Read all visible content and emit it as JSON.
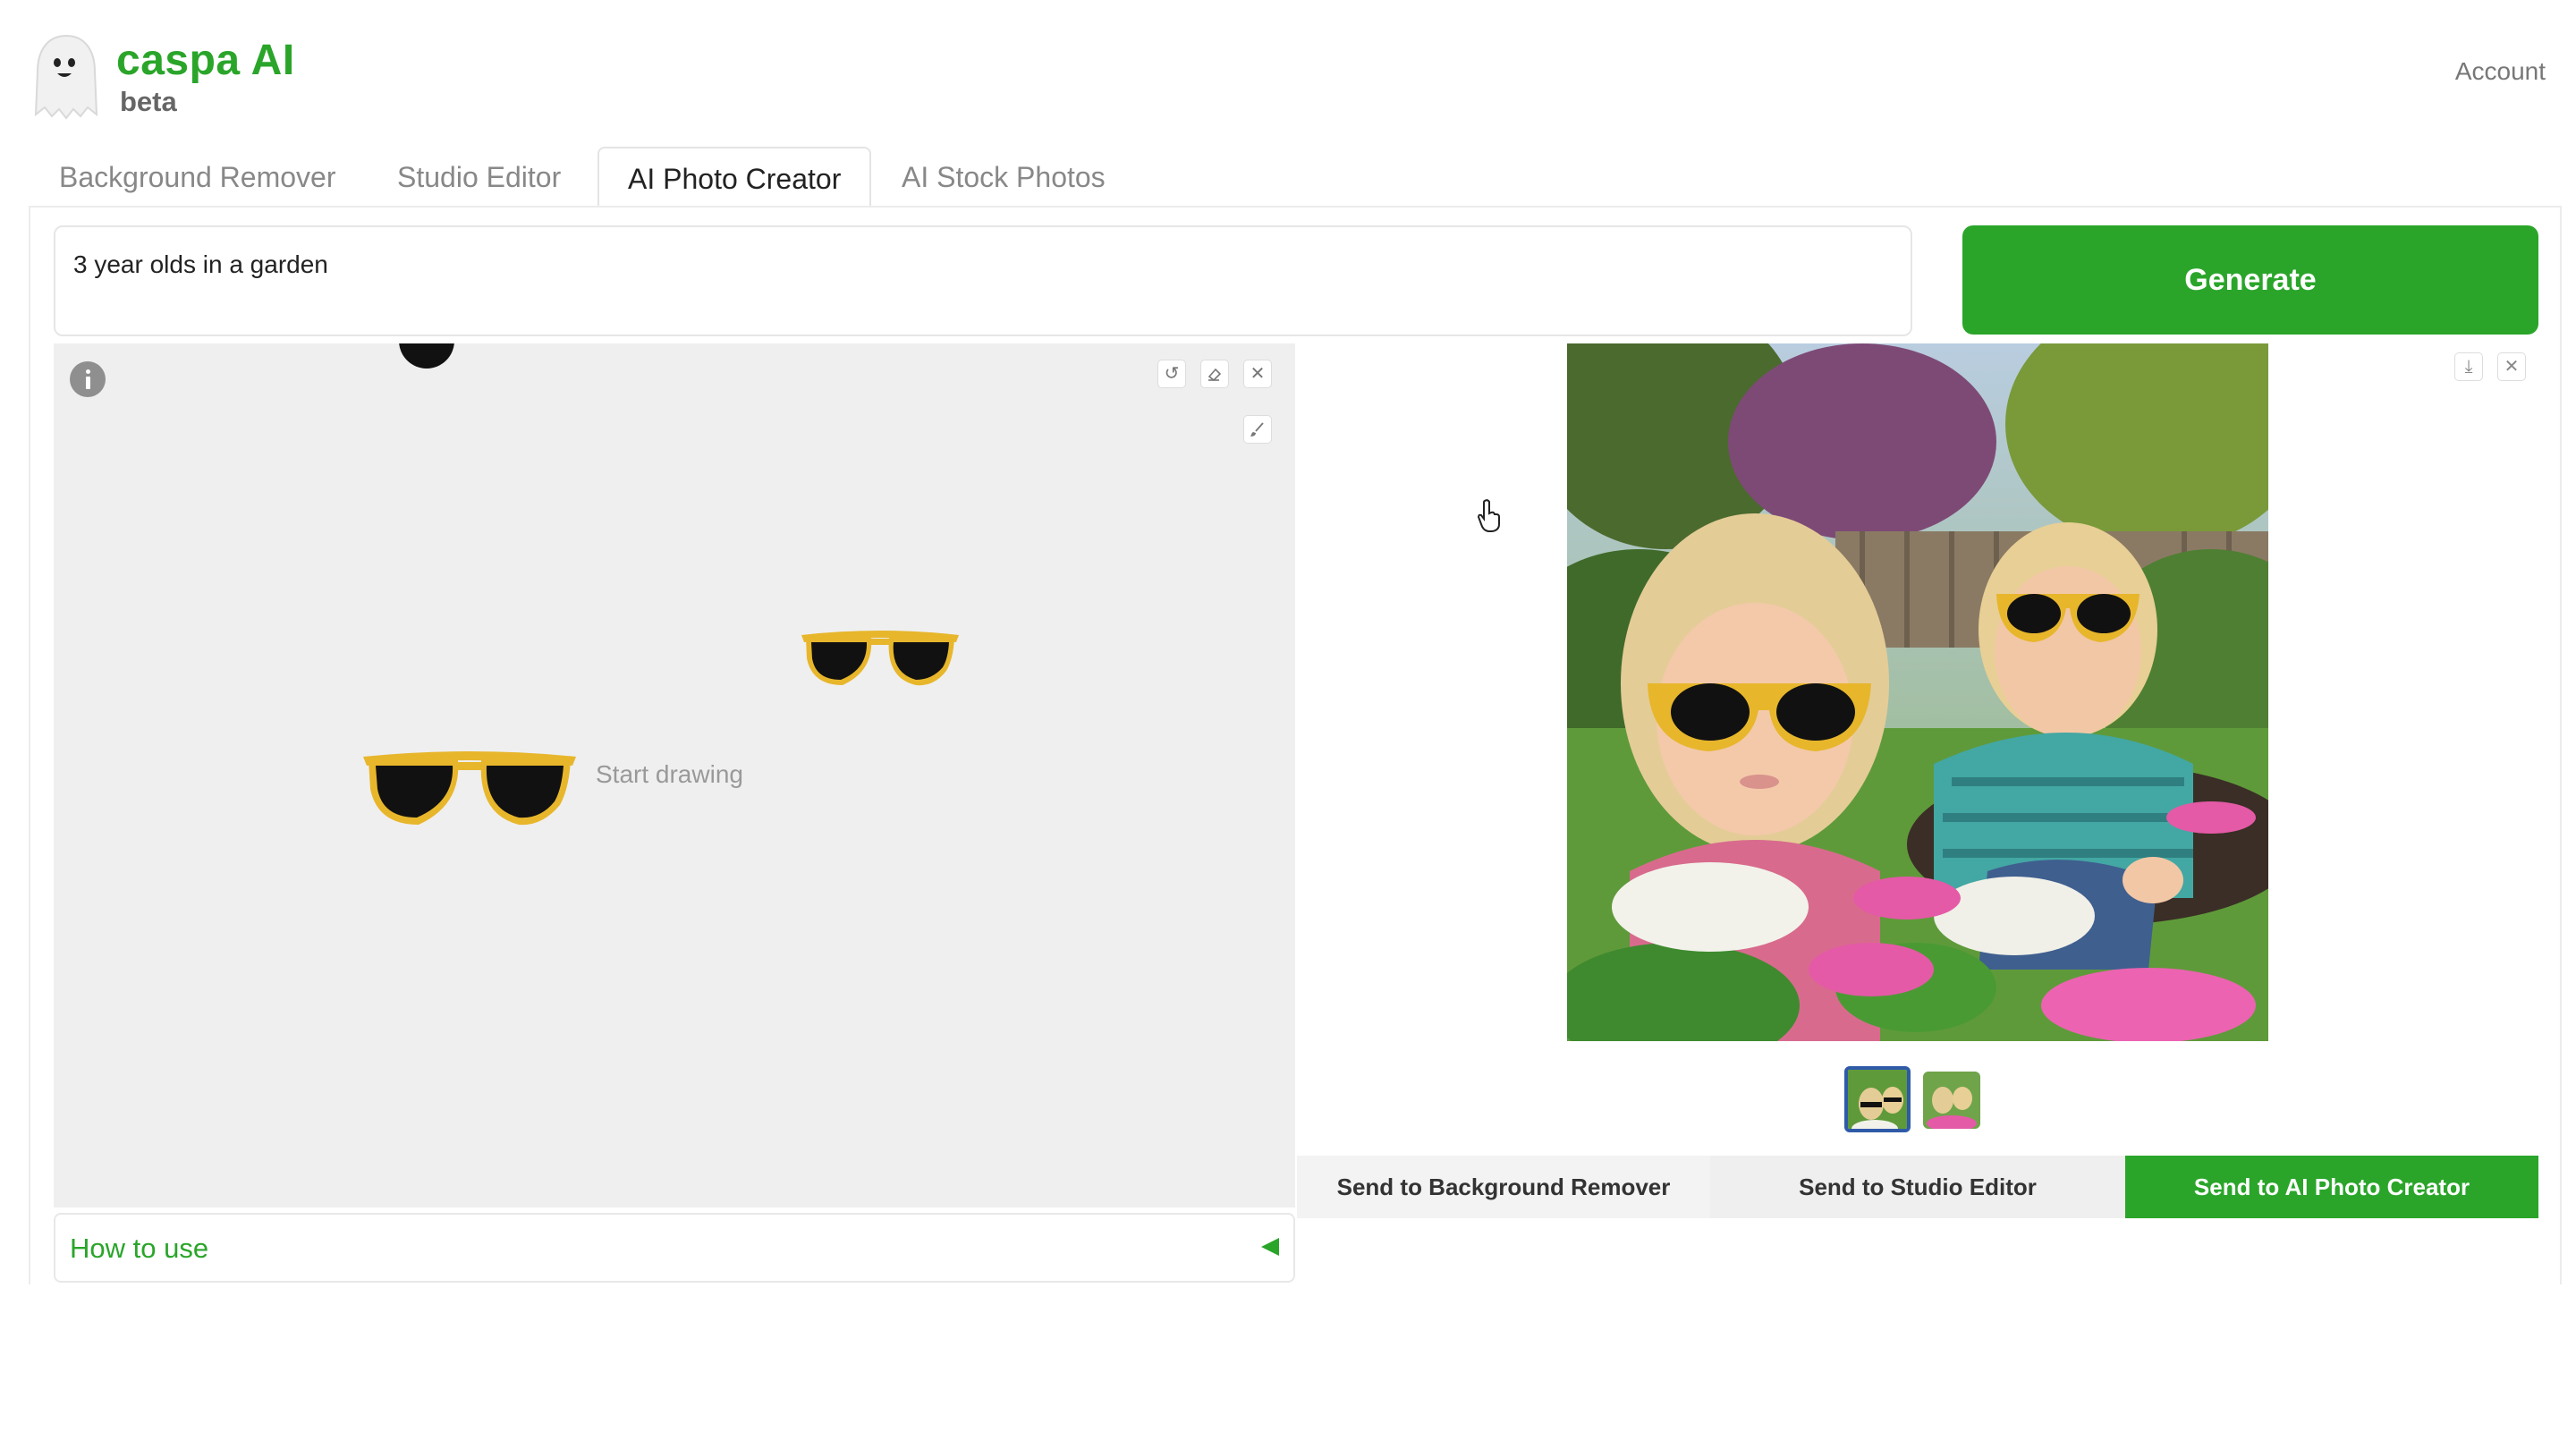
{
  "app": {
    "brand": "caspa AI",
    "badge": "beta",
    "account_label": "Account"
  },
  "tabs": [
    {
      "label": "Background Remover",
      "active": false
    },
    {
      "label": "Studio Editor",
      "active": false
    },
    {
      "label": "AI Photo Creator",
      "active": true
    },
    {
      "label": "AI Stock Photos",
      "active": false
    }
  ],
  "prompt": {
    "value": "3 year olds in a garden"
  },
  "generate_label": "Generate",
  "canvas": {
    "hint": "Start drawing"
  },
  "how_to_use_label": "How to use",
  "result": {
    "thumbnail_count": 2,
    "selected_thumbnail": 1
  },
  "send_actions": [
    {
      "label": "Send to Background Remover",
      "primary": false
    },
    {
      "label": "Send to Studio Editor",
      "primary": false
    },
    {
      "label": "Send to AI Photo Creator",
      "primary": true
    }
  ],
  "colors": {
    "accent": "#2aa52a",
    "canvas_bg": "#efefef",
    "thumb_selected": "#2f5aa8"
  },
  "icons": [
    "ghost-logo-icon",
    "info-icon",
    "undo-icon",
    "eraser-icon",
    "close-icon",
    "brush-icon",
    "download-icon",
    "triangle-left-icon",
    "hand-cursor-icon"
  ]
}
